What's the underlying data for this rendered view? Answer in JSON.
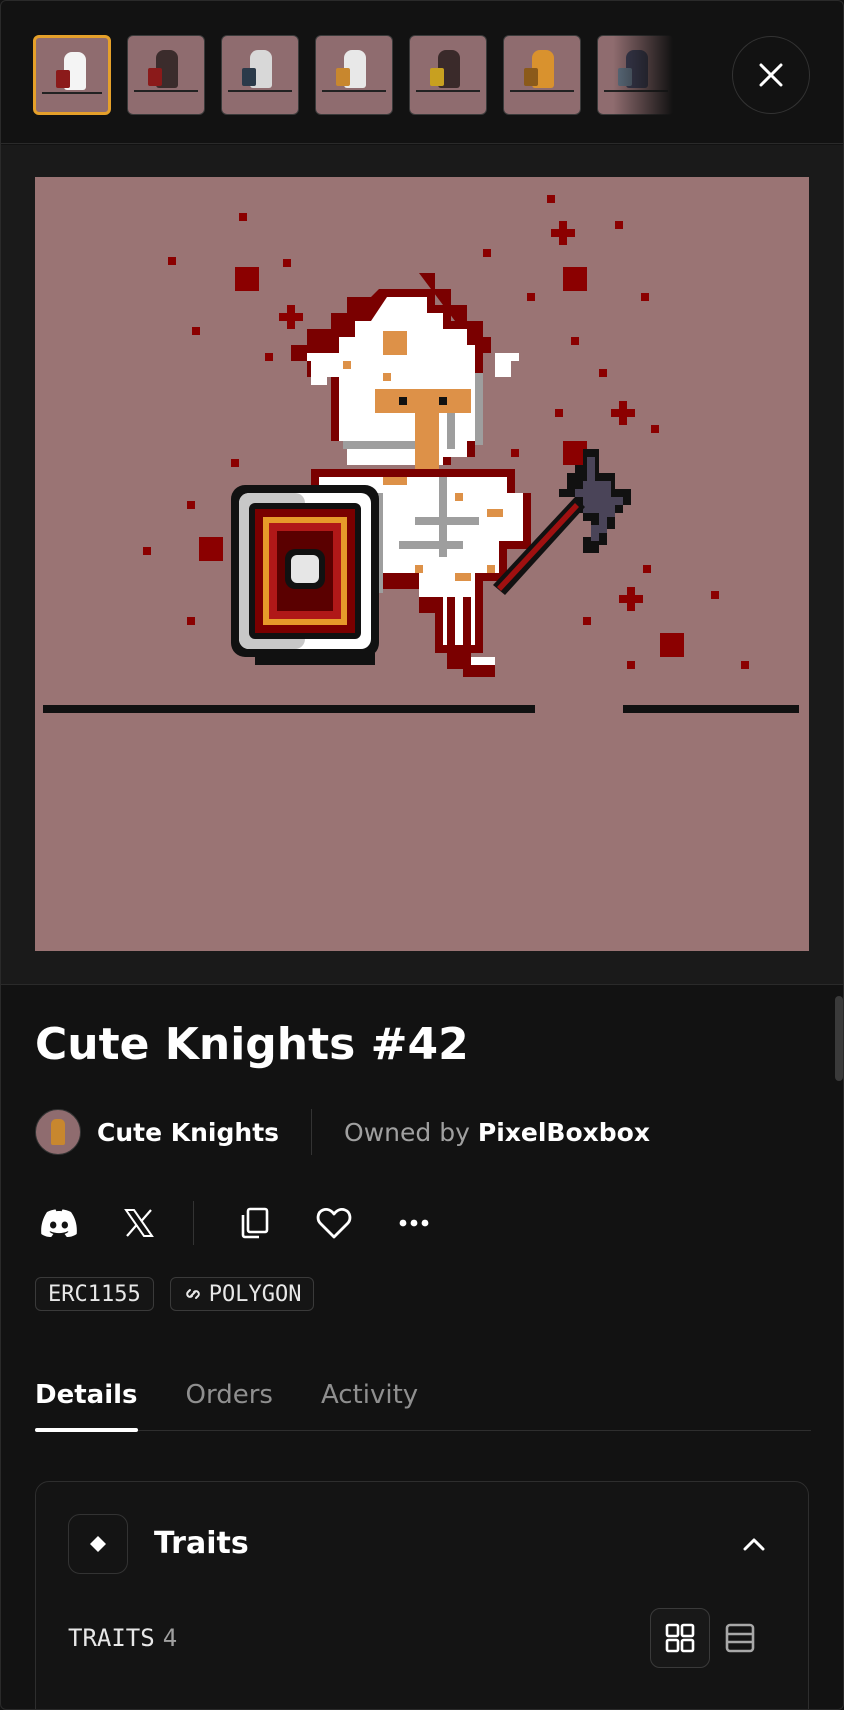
{
  "close_label": "Close",
  "thumbnails": [
    {
      "name": "thumb-1",
      "active": true,
      "fig": "#f4f4f4",
      "shield": "#8b1a1a"
    },
    {
      "name": "thumb-2",
      "active": false,
      "fig": "#3b2c2c",
      "shield": "#8b1a1a"
    },
    {
      "name": "thumb-3",
      "active": false,
      "fig": "#d8d8d8",
      "shield": "#2b3a4a"
    },
    {
      "name": "thumb-4",
      "active": false,
      "fig": "#e8e8e8",
      "shield": "#c8872e"
    },
    {
      "name": "thumb-5",
      "active": false,
      "fig": "#3a2a2a",
      "shield": "#c8a020"
    },
    {
      "name": "thumb-6",
      "active": false,
      "fig": "#d9922e",
      "shield": "#8b5a1a"
    },
    {
      "name": "thumb-7",
      "active": false,
      "fig": "#3a3a50",
      "shield": "#5a6a7a"
    }
  ],
  "nft": {
    "title": "Cute Knights #42",
    "collection": "Cute Knights",
    "owned_prefix": "Owned by",
    "owner": "PixelBoxbox"
  },
  "actions": [
    "discord-icon",
    "x-icon",
    "copy-icon",
    "heart-icon",
    "more-icon"
  ],
  "chips": {
    "standard": "ERC1155",
    "chain": "POLYGON"
  },
  "tabs": {
    "details": "Details",
    "orders": "Orders",
    "activity": "Activity"
  },
  "traits": {
    "title": "Traits",
    "count_label": "TRAITS",
    "count": "4"
  },
  "colors": {
    "background": "#121212",
    "image_bg": "#9a7474",
    "active_thumb_border": "#e5a02a"
  }
}
